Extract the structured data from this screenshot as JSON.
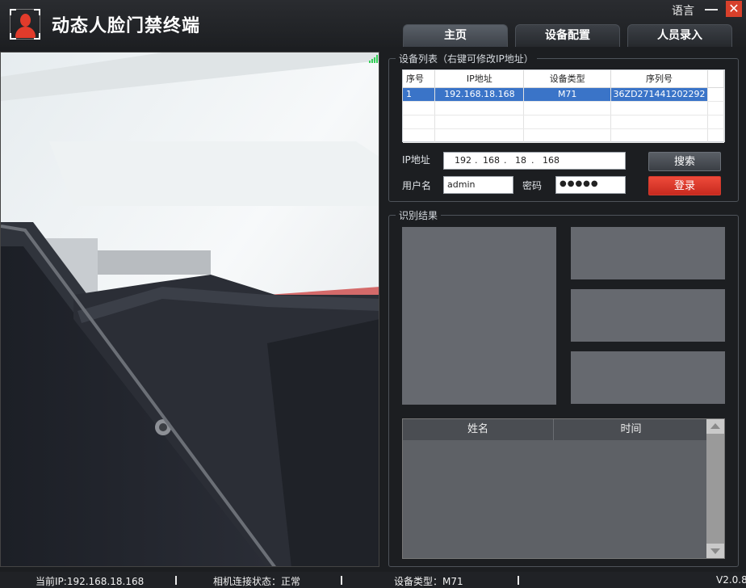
{
  "app": {
    "title": "动态人脸门禁终端",
    "language_label": "语言",
    "close_glyph": "✕"
  },
  "tabs": [
    {
      "label": "主页",
      "active": true
    },
    {
      "label": "设备配置",
      "active": false
    },
    {
      "label": "人员录入",
      "active": false
    }
  ],
  "device_list": {
    "legend": "设备列表（右键可修改IP地址）",
    "columns": [
      "序号",
      "IP地址",
      "设备类型",
      "序列号"
    ],
    "rows": [
      [
        "1",
        "192.168.18.168",
        "M71",
        "36ZD271441202292"
      ]
    ]
  },
  "login": {
    "ip_label": "IP地址",
    "ip_octets": [
      "192",
      "168",
      "18",
      "168"
    ],
    "ip_dot": ".",
    "user_label": "用户名",
    "user_value": "admin",
    "pwd_label": "密码",
    "pwd_value": "●●●●●",
    "search_button": "搜索",
    "login_button": "登录"
  },
  "recognition": {
    "legend": "识别结果",
    "columns": [
      "姓名",
      "时间"
    ]
  },
  "status": {
    "current_ip": "当前IP:192.168.18.168",
    "camera_state": "相机连接状态：正常",
    "device_type": "设备类型：M71",
    "version": "V2.0.8"
  },
  "colors": {
    "accent_red": "#e23b2b",
    "selection_blue": "#3a74c8",
    "signal_green": "#34d058"
  }
}
